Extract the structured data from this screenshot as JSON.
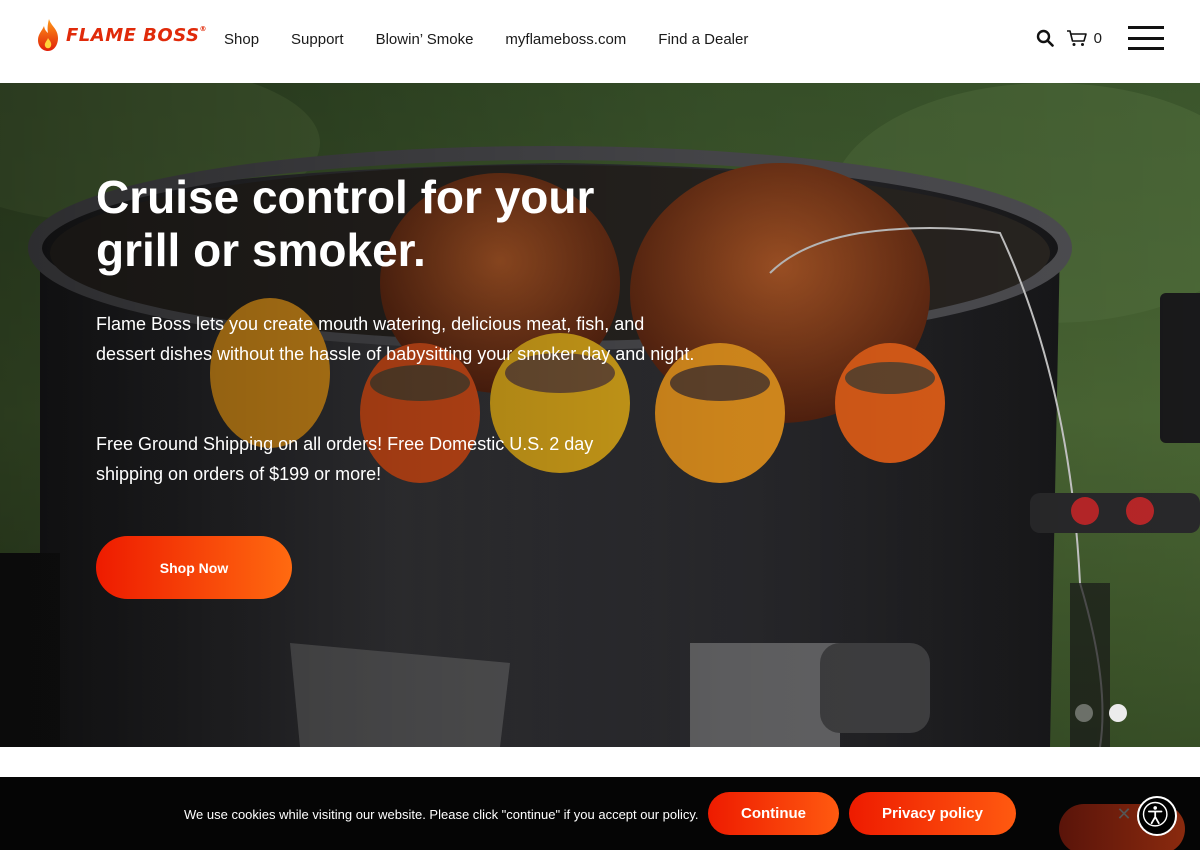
{
  "brand": {
    "name": "FLAME BOSS",
    "reg": "®"
  },
  "nav": {
    "items": [
      {
        "label": "Shop"
      },
      {
        "label": "Support"
      },
      {
        "label": "Blowin’ Smoke"
      },
      {
        "label": "myflameboss.com"
      },
      {
        "label": "Find a Dealer"
      }
    ]
  },
  "header": {
    "cart_count": "0",
    "icons": [
      "search-icon",
      "cart-icon",
      "menu-icon"
    ]
  },
  "hero": {
    "title_line1": "Cruise control for your",
    "title_line2": "grill or smoker.",
    "description": "Flame Boss lets you create mouth watering, delicious meat, fish, and dessert dishes without the hassle of babysitting your smoker day and night.",
    "shipping": "Free Ground Shipping on all orders! Free Domestic U.S. 2 day shipping on orders of $199 or more!",
    "cta_label": "Shop Now",
    "slides_total": 2,
    "active_slide": 2
  },
  "cookie": {
    "message": "We use cookies while visiting our website. Please click \"continue\" if you accept our policy.",
    "continue_label": "Continue",
    "privacy_label": "Privacy policy",
    "close_glyph": "✕"
  },
  "colors": {
    "brand_red": "#e02a0a",
    "button_gradient_start": "#ee1b00",
    "button_gradient_end": "#ff6a10"
  }
}
